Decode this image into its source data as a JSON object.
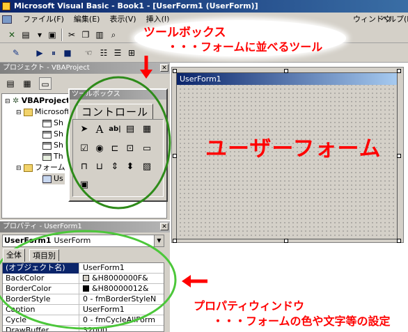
{
  "window": {
    "title": "Microsoft Visual Basic - Book1 - [UserForm1 (UserForm)]"
  },
  "menu": {
    "items": [
      "ファイル(F)",
      "編集(E)",
      "表示(V)",
      "挿入(I)"
    ],
    "right_items": [
      "ウィンドウ",
      "ヘルプ(H)"
    ]
  },
  "project": {
    "title": "プロジェクト - VBAProject",
    "tree": [
      {
        "label": "VBAProject",
        "icon": "vba-project-icon"
      },
      {
        "label": "Microsoft",
        "icon": "folder-icon"
      },
      {
        "label": "Sh",
        "icon": "sheet-icon"
      },
      {
        "label": "Sh",
        "icon": "sheet-icon"
      },
      {
        "label": "Sh",
        "icon": "sheet-icon"
      },
      {
        "label": "Th",
        "icon": "workbook-icon"
      },
      {
        "label": "フォーム",
        "icon": "folder-icon"
      },
      {
        "label": "Us",
        "icon": "form-icon"
      }
    ]
  },
  "toolbox": {
    "title": "ツールボックス",
    "tab": "コントロール",
    "tools": [
      "pointer-icon",
      "label-icon",
      "textbox-icon",
      "combobox-icon",
      "listbox-icon",
      "checkbox-icon",
      "optionbutton-icon",
      "togglebutton-icon",
      "frame-icon",
      "commandbutton-icon",
      "tabstrip-icon",
      "multipage-icon",
      "scrollbar-icon",
      "spinbutton-icon",
      "image-icon",
      "refedit-icon"
    ],
    "label_glyph": "A",
    "textbox_glyph": "ab|"
  },
  "userform": {
    "title": "UserForm1"
  },
  "properties": {
    "title": "プロパティ - UserForm1",
    "object_name": "UserForm1",
    "object_type": "UserForm",
    "tabs": [
      "全体",
      "項目別"
    ],
    "rows": [
      {
        "name": "(オブジェクト名)",
        "value": "UserForm1"
      },
      {
        "name": "BackColor",
        "value": "&H8000000F&",
        "swatch": "#d4d0c8"
      },
      {
        "name": "BorderColor",
        "value": "&H80000012&",
        "swatch": "#000000"
      },
      {
        "name": "BorderStyle",
        "value": "0 - fmBorderStyleN"
      },
      {
        "name": "Caption",
        "value": "UserForm1"
      },
      {
        "name": "Cycle",
        "value": "0 - fmCycleAllForm"
      },
      {
        "name": "DrawBuffer",
        "value": "32000"
      }
    ]
  },
  "annotations": {
    "toolbox_title": "ツールボックス",
    "toolbox_desc": "・・・フォームに並べるツール",
    "userform_label": "ユーザーフォーム",
    "props_title": "プロパティウィンドウ",
    "props_desc": "・・・フォームの色や文字等の設定"
  },
  "colors": {
    "annotation_red": "#ff0000",
    "circle_green": "#2e8b1a",
    "circle_light_green": "#4cc73a",
    "titlebar": "#0a246a"
  }
}
